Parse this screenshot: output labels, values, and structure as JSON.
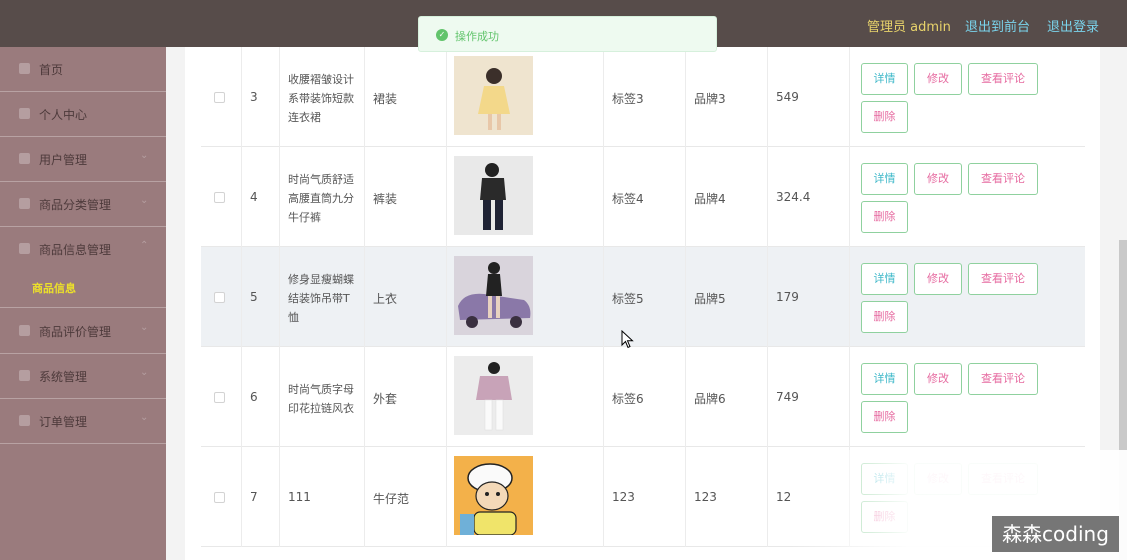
{
  "header": {
    "admin_label": "管理员 admin",
    "front_label": "退出到前台",
    "logout_label": "退出登录"
  },
  "sidebar": {
    "items": [
      {
        "label": "首页",
        "icon": "home-icon"
      },
      {
        "label": "个人中心",
        "icon": "person-icon"
      },
      {
        "label": "用户管理",
        "icon": "users-icon"
      },
      {
        "label": "商品分类管理",
        "icon": "category-icon"
      },
      {
        "label": "商品信息管理",
        "icon": "product-icon"
      },
      {
        "label": "商品评价管理",
        "icon": "review-icon"
      },
      {
        "label": "系统管理",
        "icon": "system-icon"
      },
      {
        "label": "订单管理",
        "icon": "order-icon"
      }
    ],
    "active_sub": "商品信息"
  },
  "toast": {
    "message": "操作成功",
    "color": "#62c46c"
  },
  "table": {
    "rows": [
      {
        "index": "3",
        "name": "收腰褶皱设计系带装饰短款连衣裙",
        "category": "裙装",
        "tag": "标签3",
        "brand": "品牌3",
        "price": "549",
        "thumb": "yellow-dress"
      },
      {
        "index": "4",
        "name": "时尚气质舒适高腰直筒九分牛仔裤",
        "category": "裤装",
        "tag": "标签4",
        "brand": "品牌4",
        "price": "324.4",
        "thumb": "dark-jeans"
      },
      {
        "index": "5",
        "name": "修身显瘦蝴蝶结装饰吊带T恤",
        "category": "上衣",
        "tag": "标签5",
        "brand": "品牌5",
        "price": "179",
        "thumb": "purple-car"
      },
      {
        "index": "6",
        "name": "时尚气质字母印花拉链风衣",
        "category": "外套",
        "tag": "标签6",
        "brand": "品牌6",
        "price": "749",
        "thumb": "pink-jacket"
      },
      {
        "index": "7",
        "name": "111",
        "category": "牛仔范",
        "tag": "123",
        "brand": "123",
        "price": "12",
        "thumb": "cartoon"
      }
    ],
    "buttons": {
      "detail": "详情",
      "edit": "修改",
      "review": "查看评论",
      "delete": "删除"
    }
  },
  "watermark": "森森coding"
}
